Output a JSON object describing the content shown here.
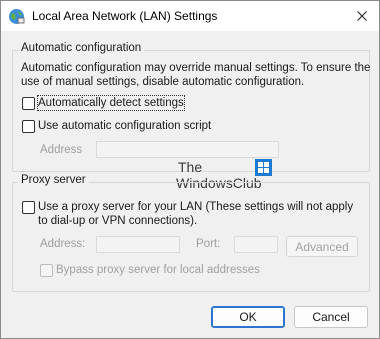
{
  "window": {
    "title": "Local Area Network (LAN) Settings",
    "icon": "network-globe-icon",
    "close_icon": "close-icon"
  },
  "auto_config": {
    "legend": "Automatic configuration",
    "description": "Automatic configuration may override manual settings.  To ensure the use of manual settings, disable automatic configuration.",
    "detect_label": "Automatically detect settings",
    "detect_checked": false,
    "script_label": "Use automatic configuration script",
    "script_checked": false,
    "address_label": "Address",
    "address_value": ""
  },
  "proxy": {
    "legend": "Proxy server",
    "use_proxy_label": "Use a proxy server for your LAN (These settings will not apply to dial-up or VPN connections).",
    "use_proxy_checked": false,
    "address_label": "Address:",
    "address_value": "",
    "port_label": "Port:",
    "port_value": "",
    "advanced_label": "Advanced",
    "bypass_label": "Bypass proxy server for local addresses",
    "bypass_checked": false
  },
  "buttons": {
    "ok": "OK",
    "cancel": "Cancel"
  },
  "watermark": {
    "line1": "The",
    "line2": "WindowsClub",
    "logo": "windows-logo-icon"
  },
  "colors": {
    "accent": "#2b74cf",
    "dialog_bg": "#f0f0f0"
  }
}
